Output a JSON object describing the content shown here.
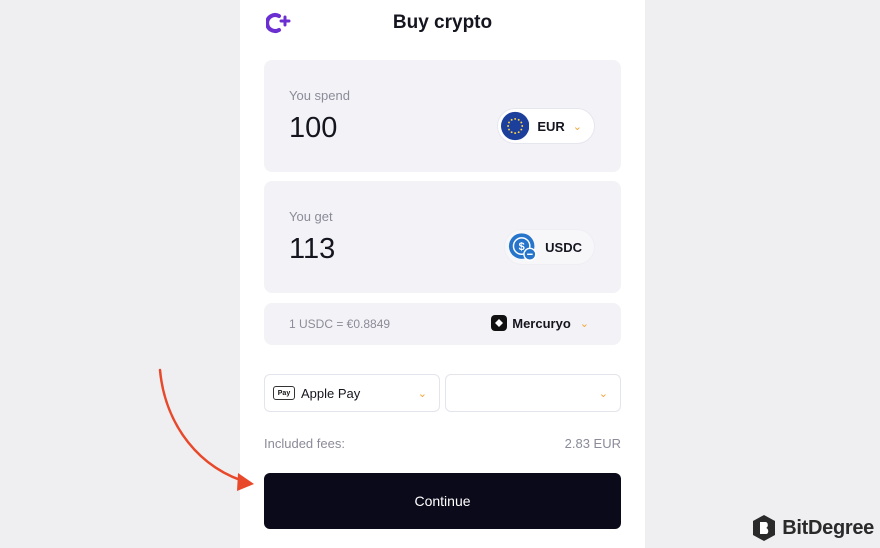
{
  "header": {
    "title": "Buy crypto",
    "logo_icon": "crypto-logo-icon"
  },
  "spend": {
    "label": "You spend",
    "amount": "100",
    "currency": "EUR",
    "currency_icon": "eu-flag-icon"
  },
  "get": {
    "label": "You get",
    "amount": "113",
    "currency": "USDC",
    "currency_icon": "usdc-icon"
  },
  "rate": {
    "text": "1 USDC = €0.8849",
    "provider": "Mercuryo",
    "provider_icon": "mercuryo-logo-icon"
  },
  "payment": {
    "method": "Apple Pay",
    "method_badge": "Pay",
    "second_select": ""
  },
  "fees": {
    "label": "Included fees:",
    "value": "2.83 EUR"
  },
  "continue_label": "Continue",
  "watermark": {
    "text": "BitDegree"
  },
  "colors": {
    "accent": "#f0a63a",
    "button": "#0b0a1a",
    "panel": "#f3f3f7",
    "logo": "#6b2fd1",
    "arrow": "#e8492b"
  }
}
